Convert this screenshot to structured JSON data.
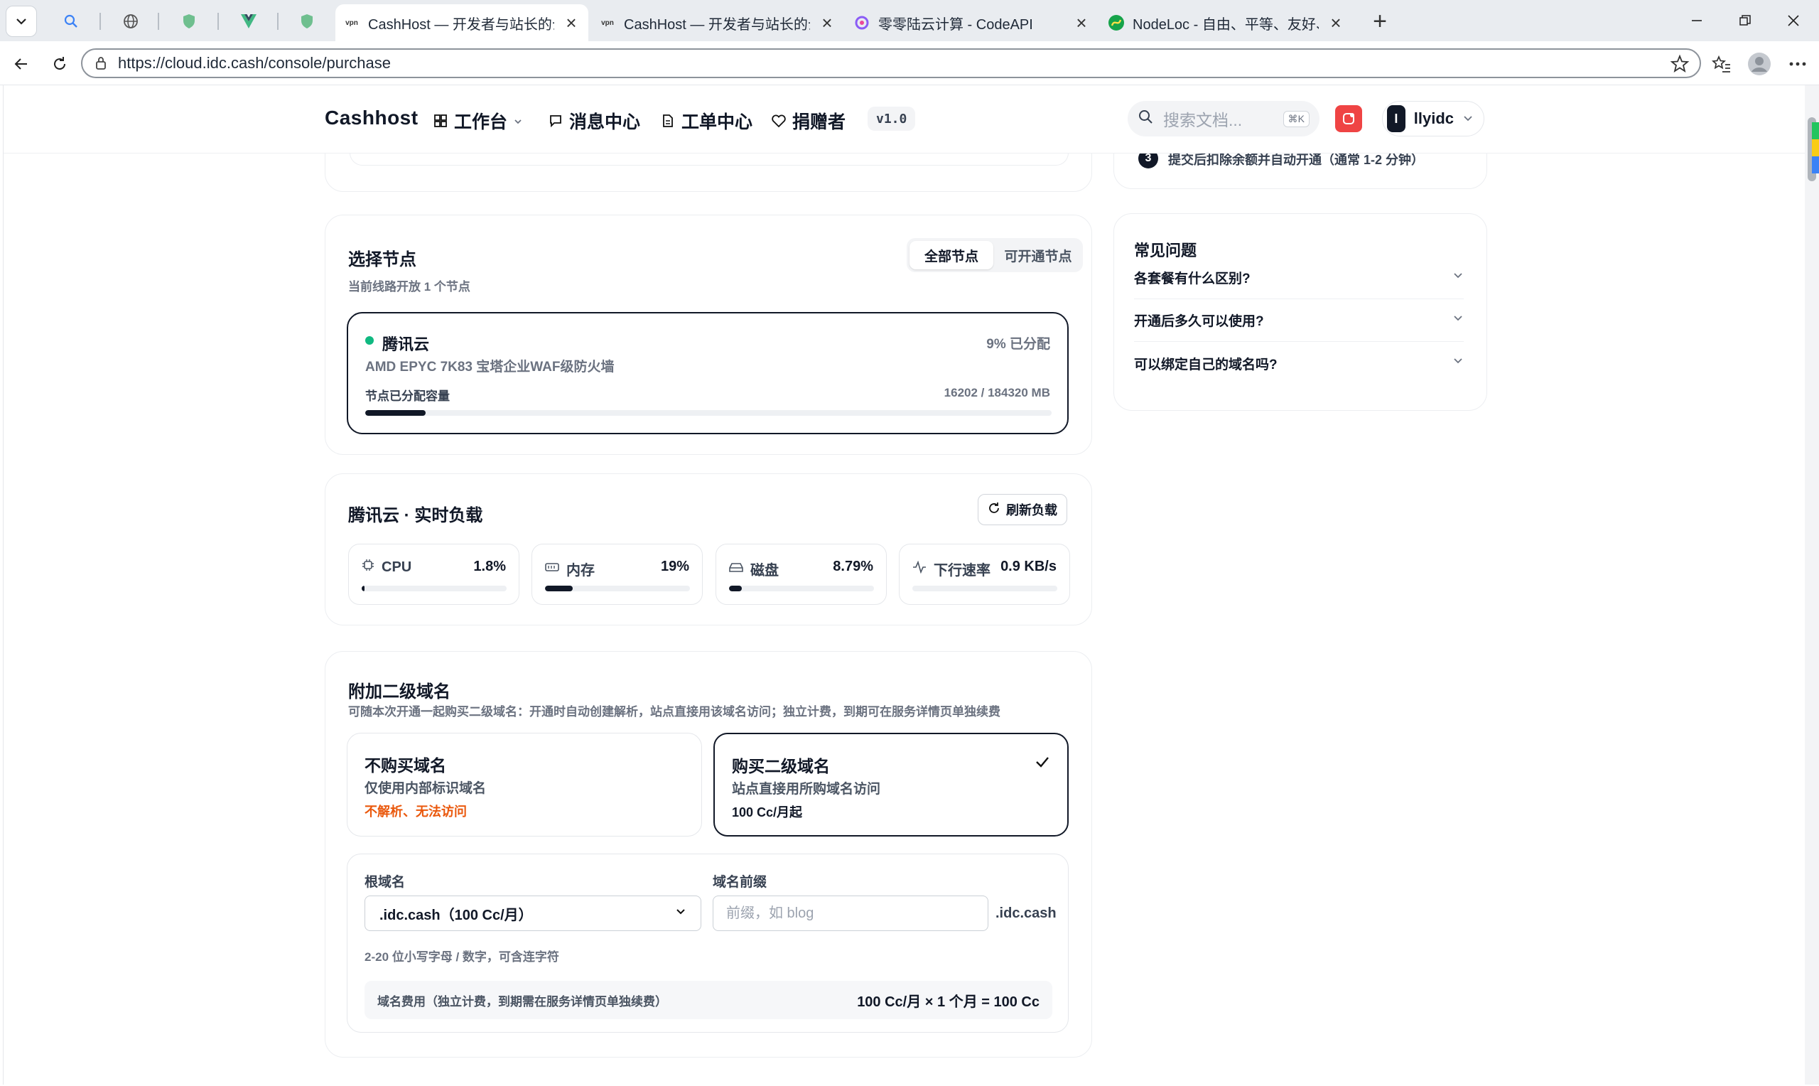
{
  "browser": {
    "tabs": [
      {
        "title": "CashHost — 开发者与站长的云托管",
        "favicon": "vpn",
        "active": true
      },
      {
        "title": "CashHost — 开发者与站长的云托管",
        "favicon": "vpn",
        "active": false
      },
      {
        "title": "零零陆云计算 - CodeAPI",
        "favicon": "codeapi",
        "active": false
      },
      {
        "title": "NodeLoc - 自由、平等、友好、开放",
        "favicon": "nodeloc",
        "active": false
      }
    ],
    "url": "https://cloud.idc.cash/console/purchase"
  },
  "header": {
    "brand": "Cashhost",
    "nav": {
      "workbench": "工作台",
      "messages": "消息中心",
      "orders": "工单中心",
      "sponsors": "捐赠者"
    },
    "version": "v1.0",
    "search_placeholder": "搜索文档...",
    "search_shortcut": "⌘K",
    "user_initial": "I",
    "username": "llyidc"
  },
  "steps": {
    "step3_number": "3",
    "step3_text": "提交后扣除余额并自动开通（通常 1-2 分钟）"
  },
  "node_select": {
    "title": "选择节点",
    "subtitle": "当前线路开放 1 个节点",
    "tabs": [
      "全部节点",
      "可开通节点"
    ],
    "node": {
      "name": "腾讯云",
      "status_color": "#10b981",
      "alloc_pct_text": "9% 已分配",
      "desc": "AMD EPYC 7K83 宝塔企业WAF级防火墙",
      "capacity_label": "节点已分配容量",
      "capacity_value": "16202 / 184320 MB",
      "capacity_fraction": 0.088
    }
  },
  "load": {
    "title": "腾讯云 · 实时负载",
    "refresh": "刷新负载",
    "metrics": [
      {
        "label": "CPU",
        "value": "1.8%",
        "fraction": 0.018,
        "icon": "cpu-icon"
      },
      {
        "label": "内存",
        "value": "19%",
        "fraction": 0.19,
        "icon": "memory-icon"
      },
      {
        "label": "磁盘",
        "value": "8.79%",
        "fraction": 0.0879,
        "icon": "disk-icon"
      },
      {
        "label": "下行速率",
        "value": "0.9 KB/s",
        "fraction": 0.0,
        "icon": "activity-icon"
      }
    ]
  },
  "domain": {
    "title": "附加二级域名",
    "subtitle": "可随本次开通一起购买二级域名：开通时自动创建解析，站点直接用该域名访问；独立计费，到期可在服务详情页单独续费",
    "options": [
      {
        "title": "不购买域名",
        "desc": "仅使用内部标识域名",
        "note": "不解析、无法访问",
        "note_color": "#ea580c",
        "selected": false
      },
      {
        "title": "购买二级域名",
        "desc": "站点直接用所购域名访问",
        "note": "100 Cc/月起",
        "note_color": "#111827",
        "selected": true
      }
    ],
    "root_label": "根域名",
    "root_value": ".idc.cash（100 Cc/月）",
    "prefix_label": "域名前缀",
    "prefix_placeholder": "前缀，如 blog",
    "suffix": ".idc.cash",
    "hint": "2-20 位小写字母 / 数字，可含连字符",
    "fee_label": "域名费用（独立计费，到期需在服务详情页单独续费）",
    "fee_value": "100 Cc/月 × 1 个月 = 100 Cc"
  },
  "faq": {
    "title": "常见问题",
    "items": [
      "各套餐有什么区别?",
      "开通后多久可以使用?",
      "可以绑定自己的域名吗?"
    ]
  }
}
